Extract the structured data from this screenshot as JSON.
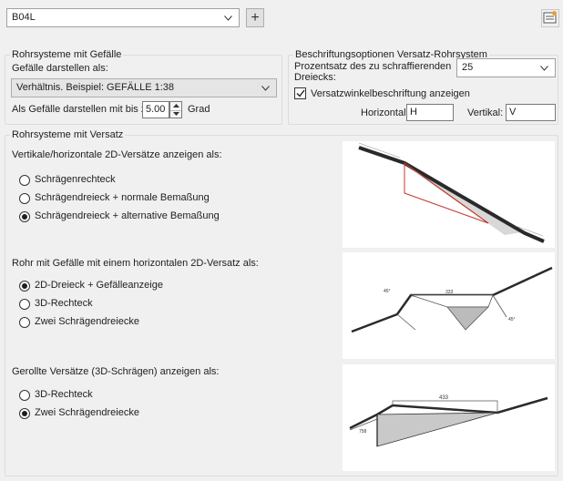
{
  "top": {
    "style_value": "B04L",
    "add_glyph": "+"
  },
  "gradient_group": {
    "title": "Rohrsysteme mit Gefälle",
    "display_label": "Gefälle darstellen als:",
    "display_value": "Verhältnis. Beispiel: GEFÄLLE 1:38",
    "max_label": "Als Gefälle darstellen mit bis zu:",
    "max_value": "5.00",
    "max_unit": "Grad"
  },
  "label_group": {
    "title": "Beschriftungsoptionen Versatz-Rohrsystem",
    "hatch_label_line1": "Prozentsatz des zu schraffierenden",
    "hatch_label_line2": "Dreiecks:",
    "hatch_value": "25",
    "angle_check_label": "Versatzwinkelbeschriftung anzeigen",
    "angle_check_checked": true,
    "horizontal_label": "Horizontal:",
    "horizontal_value": "H",
    "vertical_label": "Vertikal:",
    "vertical_value": "V"
  },
  "offset_group": {
    "title": "Rohrsysteme mit Versatz",
    "section1": {
      "heading": "Vertikale/horizontale 2D-Versätze anzeigen als:",
      "options": [
        {
          "label": "Schrägenrechteck",
          "selected": false
        },
        {
          "label": "Schrägendreieck + normale Bemaßung",
          "selected": false
        },
        {
          "label": "Schrägendreieck + alternative Bemaßung",
          "selected": true
        }
      ]
    },
    "section2": {
      "heading": "Rohr mit Gefälle mit einem horizontalen 2D-Versatz als:",
      "options": [
        {
          "label": "2D-Dreieck + Gefälleanzeige",
          "selected": true
        },
        {
          "label": "3D-Rechteck",
          "selected": false
        },
        {
          "label": "Zwei Schrägendreiecke",
          "selected": false
        }
      ]
    },
    "section3": {
      "heading": "Gerollte Versätze (3D-Schrägen) anzeigen als:",
      "options": [
        {
          "label": "3D-Rechteck",
          "selected": false
        },
        {
          "label": "Zwei Schrägendreiecke",
          "selected": true
        }
      ]
    }
  },
  "previews": {
    "p2_top": "333",
    "p2_angle_left": "45°",
    "p2_angle_right": "45°",
    "p3_top": "433",
    "p3_side": "758"
  },
  "icons": {
    "dropdown": "chevron-down-icon",
    "add": "plus-icon",
    "settings": "style-settings-icon"
  }
}
